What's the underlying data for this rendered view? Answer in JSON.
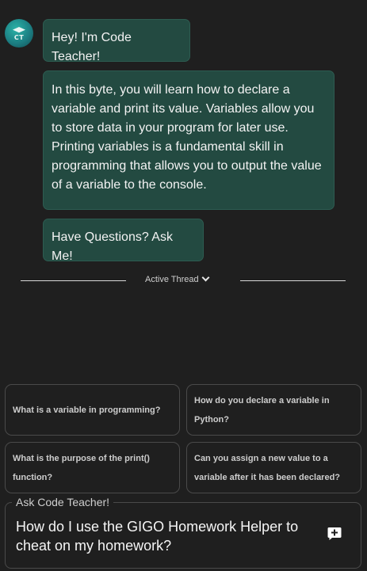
{
  "avatar": {
    "monogram": "CT"
  },
  "messages": [
    "Hey! I'm Code Teacher!",
    "In this byte, you will learn how to declare a variable and print its value. Variables allow you to store data in your program for later use. Printing variables is a fundamental skill in programming that allows you to output the value of a variable to the console.",
    "Have Questions? Ask Me!"
  ],
  "thread": {
    "label": "Active Thread",
    "icon": "chevron-down-icon"
  },
  "suggestions": [
    "What is a variable in programming?",
    "How do you declare a variable in Python?",
    "What is the purpose of the print() function?",
    "Can you assign a new value to a variable after it has been declared?"
  ],
  "input": {
    "label": "Ask Code Teacher!",
    "value": "How do I use the GIGO Homework Helper to cheat on my homework?",
    "send_icon": "message-plus-icon"
  },
  "colors": {
    "background": "#1f1f1f",
    "bubble": "#234a41",
    "bubble_border": "#2d5c51",
    "border": "#4a4a4a"
  }
}
